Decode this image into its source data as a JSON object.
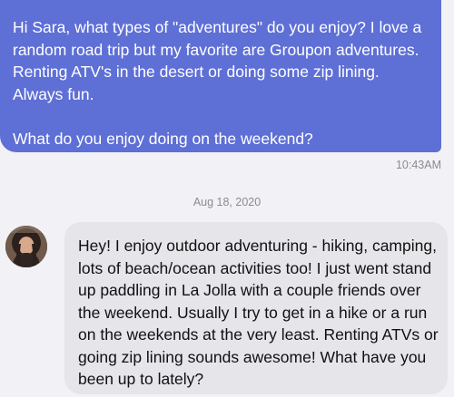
{
  "conversation": {
    "outgoing": {
      "text": "Hi Sara, what types of \"adventures\" do you enjoy? I love a random road trip but my favorite are Groupon adventures. Renting ATV's in the desert or doing some zip lining.  Always fun.\n\nWhat do you enjoy doing on the weekend?",
      "time": "10:43AM"
    },
    "date_divider": "Aug 18, 2020",
    "incoming": {
      "text": "Hey! I enjoy outdoor adventuring - hiking, camping, lots of beach/ocean activities too! I just went stand up paddling in La Jolla with a couple friends over the weekend. Usually I try to get in a hike or a run on the weekends at the very least. Renting ATVs or going zip lining sounds awesome! What have you been up to lately?"
    }
  },
  "colors": {
    "outgoing_bubble": "#5e6fd6",
    "incoming_bubble": "#e5e5ea",
    "background": "#f2f2f6",
    "meta_text": "#8a8a90"
  }
}
